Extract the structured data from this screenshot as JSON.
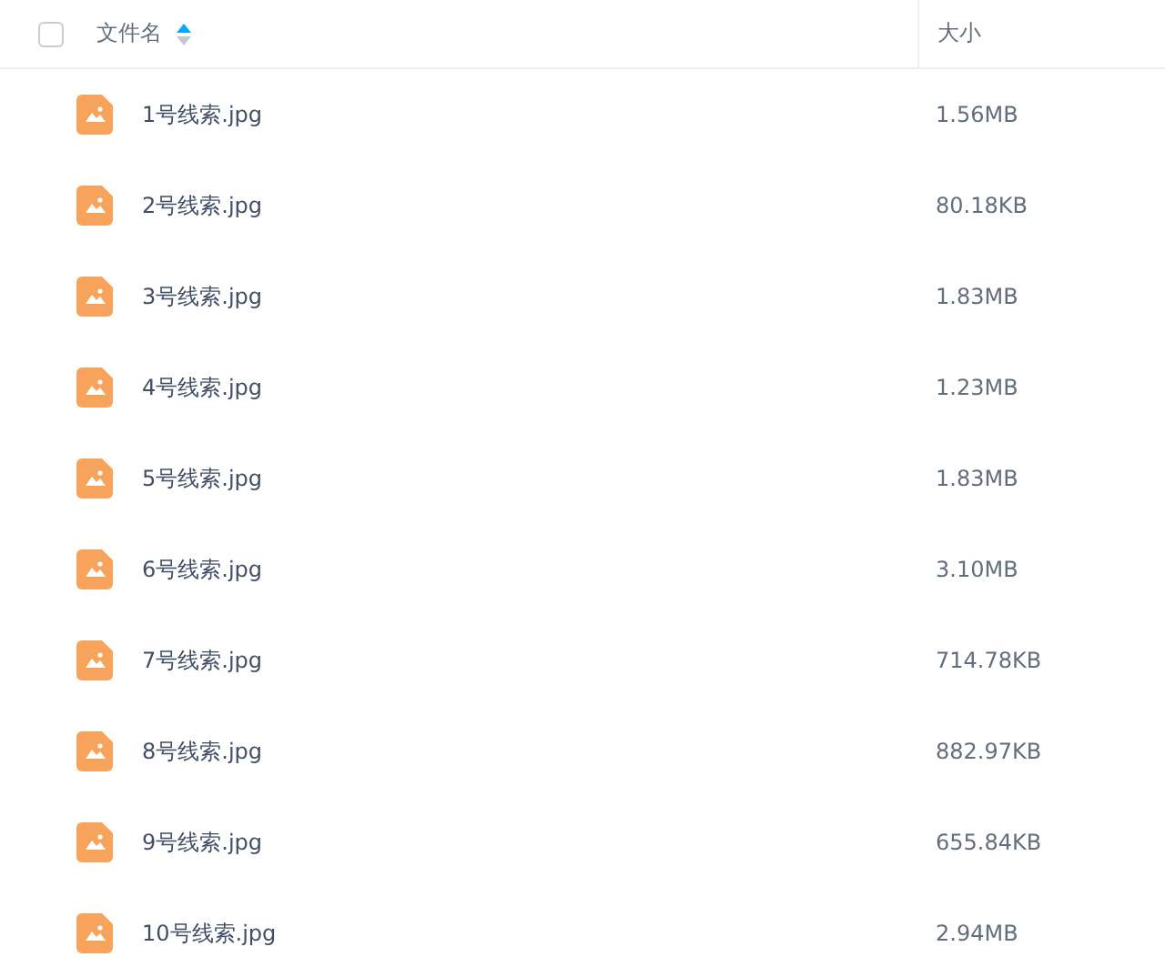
{
  "header": {
    "select_all_checked": false,
    "columns": [
      {
        "label": "文件名",
        "sorted": true
      },
      {
        "label": "大小",
        "sorted": false
      }
    ]
  },
  "files": [
    {
      "name": "1号线索.jpg",
      "size": "1.56MB"
    },
    {
      "name": "2号线索.jpg",
      "size": "80.18KB"
    },
    {
      "name": "3号线索.jpg",
      "size": "1.83MB"
    },
    {
      "name": "4号线索.jpg",
      "size": "1.23MB"
    },
    {
      "name": "5号线索.jpg",
      "size": "1.83MB"
    },
    {
      "name": "6号线索.jpg",
      "size": "3.10MB"
    },
    {
      "name": "7号线索.jpg",
      "size": "714.78KB"
    },
    {
      "name": "8号线索.jpg",
      "size": "882.97KB"
    },
    {
      "name": "9号线索.jpg",
      "size": "655.84KB"
    },
    {
      "name": "10号线索.jpg",
      "size": "2.94MB"
    }
  ]
}
